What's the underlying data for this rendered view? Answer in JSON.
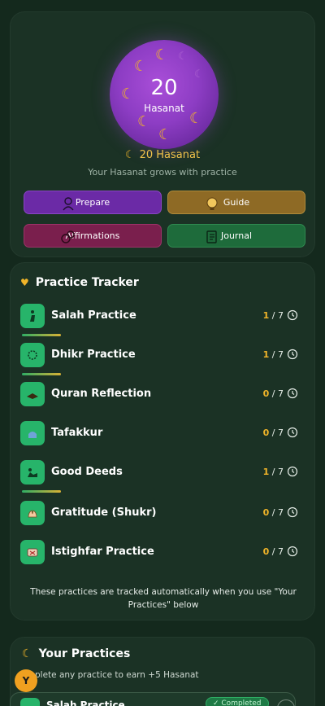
{
  "hero": {
    "count": "20",
    "count_label": "Hasanat",
    "hasanat_line": "20 Hasanat",
    "grows_text": "Your Hasanat grows with practice",
    "buttons": {
      "prepare": "Prepare",
      "guide": "Guide",
      "affirmations": "Affirmations",
      "journal": "Journal"
    }
  },
  "tracker": {
    "title": "Practice Tracker",
    "rows": [
      {
        "name": "Salah Practice",
        "done": "1",
        "total": "/ 7",
        "icon": "prayer-icon"
      },
      {
        "name": "Dhikr Practice",
        "done": "1",
        "total": "/ 7",
        "icon": "beads-icon"
      },
      {
        "name": "Quran Reflection",
        "done": "0",
        "total": "/ 7",
        "icon": "quran-icon"
      },
      {
        "name": "Tafakkur",
        "done": "0",
        "total": "/ 7",
        "icon": "mosque-icon"
      },
      {
        "name": "Good Deeds",
        "done": "1",
        "total": "/ 7",
        "icon": "deeds-icon"
      },
      {
        "name": "Gratitude (Shukr)",
        "done": "0",
        "total": "/ 7",
        "icon": "hands-icon"
      },
      {
        "name": "Istighfar Practice",
        "done": "0",
        "total": "/ 7",
        "icon": "repent-icon"
      }
    ],
    "note": "These practices are tracked automatically when you use \"Your Practices\" below"
  },
  "practices": {
    "title": "Your Practices",
    "subtitle": "plete any practice to earn +5 Hasanat",
    "avatar": "Y",
    "first_item": {
      "name": "Salah Practice",
      "badge": "✓ Completed"
    }
  },
  "colors": {
    "accent_gold": "#f0b429",
    "practice_green": "#27b46a",
    "prepare_purple": "#6b2aa6",
    "guide_gold": "#8e6a25",
    "affirm_magenta": "#7a1f4d",
    "journal_green": "#1e6b3b"
  }
}
